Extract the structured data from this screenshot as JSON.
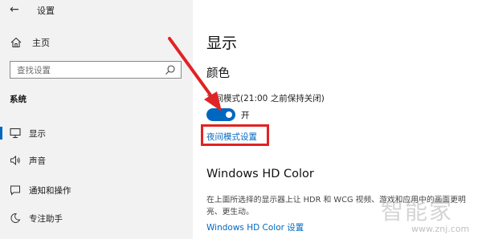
{
  "app": {
    "title": "设置"
  },
  "sidebar": {
    "home_label": "主页",
    "search_placeholder": "查找设置",
    "section_label": "系统",
    "items": [
      {
        "label": "显示",
        "icon": "monitor-icon",
        "selected": true
      },
      {
        "label": "声音",
        "icon": "speaker-icon",
        "selected": false
      },
      {
        "label": "通知和操作",
        "icon": "notification-icon",
        "selected": false
      },
      {
        "label": "专注助手",
        "icon": "moon-icon",
        "selected": false
      }
    ]
  },
  "main": {
    "page_title": "显示",
    "color_heading": "颜色",
    "night_light_label": "夜间模式(21:00 之前保持关闭)",
    "toggle_state_label": "开",
    "night_light_settings_link": "夜间模式设置",
    "hd_color_heading": "Windows HD Color",
    "hd_color_description": "在上面所选择的显示器上让 HDR 和 WCG 视频、游戏和应用中的画面更明亮、更生动。",
    "hd_color_settings_link": "Windows HD Color 设置"
  },
  "watermark": {
    "text": "智能家",
    "url": "www.znj.com"
  },
  "colors": {
    "accent": "#0067c0",
    "annotation": "#e12323",
    "sidebar_bg": "#f2f2f2"
  }
}
